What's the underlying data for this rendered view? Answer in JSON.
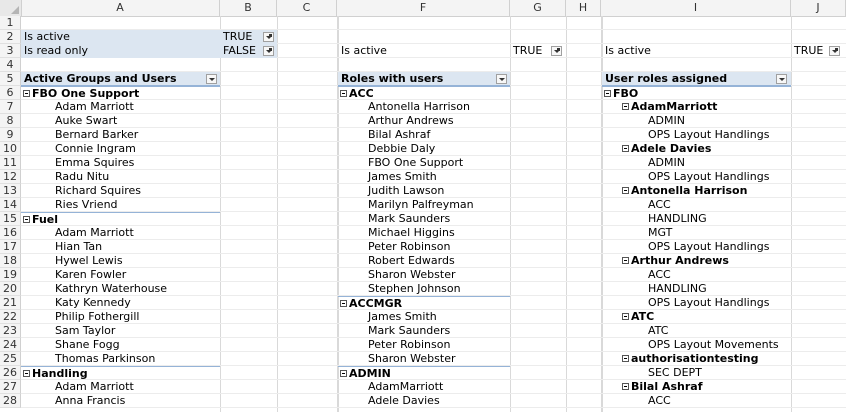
{
  "columns": [
    "A",
    "B",
    "C",
    "",
    "F",
    "G",
    "H",
    "",
    "I",
    "J"
  ],
  "rows": [
    "1",
    "2",
    "3",
    "4",
    "5",
    "6",
    "7",
    "8",
    "9",
    "10",
    "11",
    "12",
    "13",
    "14",
    "15",
    "16",
    "17",
    "18",
    "19",
    "20",
    "21",
    "22",
    "23",
    "24",
    "25",
    "26",
    "27",
    "28"
  ],
  "left_panel": {
    "filters": [
      {
        "label": "Is active",
        "value": "TRUE"
      },
      {
        "label": "Is read only",
        "value": "FALSE"
      }
    ],
    "header": "Active Groups and Users",
    "items": [
      {
        "t": "FBO One Support",
        "g": true
      },
      {
        "t": "Adam Marriott"
      },
      {
        "t": "Auke Swart"
      },
      {
        "t": "Bernard Barker"
      },
      {
        "t": "Connie Ingram"
      },
      {
        "t": "Emma Squires"
      },
      {
        "t": "Radu Nitu"
      },
      {
        "t": "Richard Squires"
      },
      {
        "t": "Ries Vriend"
      },
      {
        "t": "Fuel",
        "g": true
      },
      {
        "t": "Adam Marriott"
      },
      {
        "t": "Hian Tan"
      },
      {
        "t": "Hywel Lewis"
      },
      {
        "t": "Karen Fowler"
      },
      {
        "t": "Kathryn Waterhouse"
      },
      {
        "t": "Katy Kennedy"
      },
      {
        "t": "Philip Fothergill"
      },
      {
        "t": "Sam Taylor"
      },
      {
        "t": "Shane Fogg"
      },
      {
        "t": "Thomas Parkinson"
      },
      {
        "t": "Handling",
        "g": true
      },
      {
        "t": "Adam Marriott"
      },
      {
        "t": "Anna Francis"
      }
    ]
  },
  "mid_panel": {
    "filter": {
      "label": "Is active",
      "value": "TRUE"
    },
    "header": "Roles with users",
    "items": [
      {
        "t": "ACC",
        "g": true
      },
      {
        "t": "Antonella Harrison"
      },
      {
        "t": "Arthur Andrews"
      },
      {
        "t": "Bilal Ashraf"
      },
      {
        "t": "Debbie Daly"
      },
      {
        "t": "FBO One Support"
      },
      {
        "t": "James Smith"
      },
      {
        "t": "Judith Lawson"
      },
      {
        "t": "Marilyn Palfreyman"
      },
      {
        "t": "Mark Saunders"
      },
      {
        "t": "Michael Higgins"
      },
      {
        "t": "Peter Robinson"
      },
      {
        "t": "Robert Edwards"
      },
      {
        "t": "Sharon Webster"
      },
      {
        "t": "Stephen Johnson"
      },
      {
        "t": "ACCMGR",
        "g": true
      },
      {
        "t": "James Smith"
      },
      {
        "t": "Mark Saunders"
      },
      {
        "t": "Peter Robinson"
      },
      {
        "t": "Sharon Webster"
      },
      {
        "t": "ADMIN",
        "g": true
      },
      {
        "t": "AdamMarriott"
      },
      {
        "t": "Adele Davies"
      }
    ]
  },
  "right_panel": {
    "filter": {
      "label": "Is active",
      "value": "TRUE"
    },
    "header": "User roles assigned",
    "items": [
      {
        "t": "FBO",
        "g": true,
        "l": 0
      },
      {
        "t": "AdamMarriott",
        "g": true,
        "l": 1
      },
      {
        "t": "ADMIN",
        "l": 2
      },
      {
        "t": "OPS Layout Handlings",
        "l": 2
      },
      {
        "t": "Adele Davies",
        "g": true,
        "l": 1
      },
      {
        "t": "ADMIN",
        "l": 2
      },
      {
        "t": "OPS Layout Handlings",
        "l": 2
      },
      {
        "t": "Antonella Harrison",
        "g": true,
        "l": 1
      },
      {
        "t": "ACC",
        "l": 2
      },
      {
        "t": "HANDLING",
        "l": 2
      },
      {
        "t": "MGT",
        "l": 2
      },
      {
        "t": "OPS Layout Handlings",
        "l": 2
      },
      {
        "t": "Arthur Andrews",
        "g": true,
        "l": 1
      },
      {
        "t": "ACC",
        "l": 2
      },
      {
        "t": "HANDLING",
        "l": 2
      },
      {
        "t": "OPS Layout Handlings",
        "l": 2
      },
      {
        "t": "ATC",
        "g": true,
        "l": 1
      },
      {
        "t": "ATC",
        "l": 2
      },
      {
        "t": "OPS Layout Movements",
        "l": 2
      },
      {
        "t": "authorisationtesting",
        "g": true,
        "l": 1
      },
      {
        "t": "SEC DEPT",
        "l": 2
      },
      {
        "t": "Bilal Ashraf",
        "g": true,
        "l": 1
      },
      {
        "t": "ACC",
        "l": 2
      }
    ]
  }
}
